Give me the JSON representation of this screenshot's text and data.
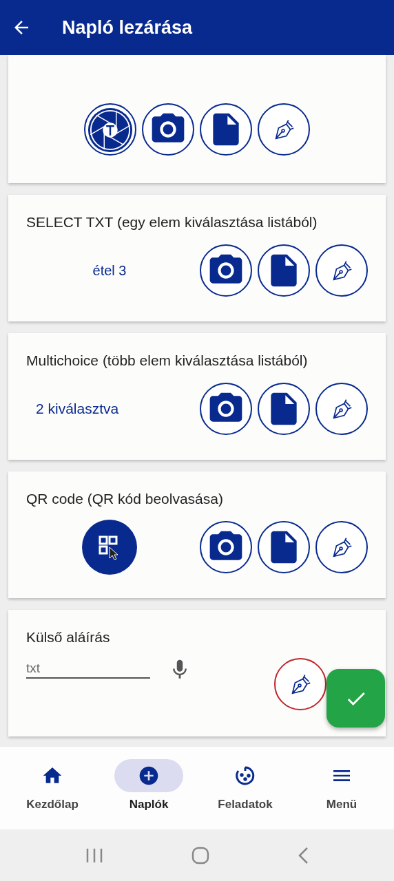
{
  "header": {
    "title": "Napló lezárása"
  },
  "cards": [
    {
      "kind": "attachments"
    },
    {
      "kind": "select",
      "title": "SELECT TXT (egy elem kiválasztása listából)",
      "value": "étel 3"
    },
    {
      "kind": "multichoice",
      "title": "Multichoice (több elem kiválasztása listából)",
      "value": "2 kiválasztva"
    },
    {
      "kind": "qr",
      "title": "QR code (QR kód beolvasása)"
    },
    {
      "kind": "signature",
      "title": "Külső aláírás",
      "placeholder": "txt",
      "invalid": true
    }
  ],
  "nav": [
    {
      "label": "Kezdőlap",
      "selected": false
    },
    {
      "label": "Naplók",
      "selected": true
    },
    {
      "label": "Feladatok",
      "selected": false
    },
    {
      "label": "Menü",
      "selected": false
    }
  ]
}
